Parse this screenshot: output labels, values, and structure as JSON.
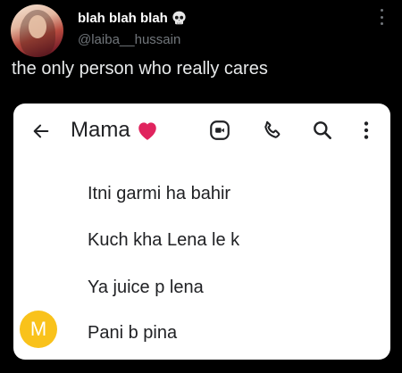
{
  "tweet": {
    "display_name": "blah blah blah",
    "name_emoji_icon": "skull-emoji",
    "handle": "@laiba__hussain",
    "text": "the only person who really cares"
  },
  "chat": {
    "contact_name": "Mama",
    "contact_emoji_icon": "red-heart-emoji",
    "toolbar_icons": [
      "back-arrow-icon",
      "video-call-icon",
      "phone-icon",
      "search-icon",
      "more-vertical-icon"
    ],
    "sender_initial": "M",
    "sender_avatar_color": "#f9c21b",
    "messages": [
      {
        "text": "Itni garmi ha bahir"
      },
      {
        "text": "Kuch kha Lena le k"
      },
      {
        "text": "Ya juice p lena"
      },
      {
        "text": "Pani b pina"
      }
    ]
  },
  "colors": {
    "background": "#000000",
    "card": "#ffffff",
    "handle": "#71767b",
    "heart": "#e0245e"
  }
}
